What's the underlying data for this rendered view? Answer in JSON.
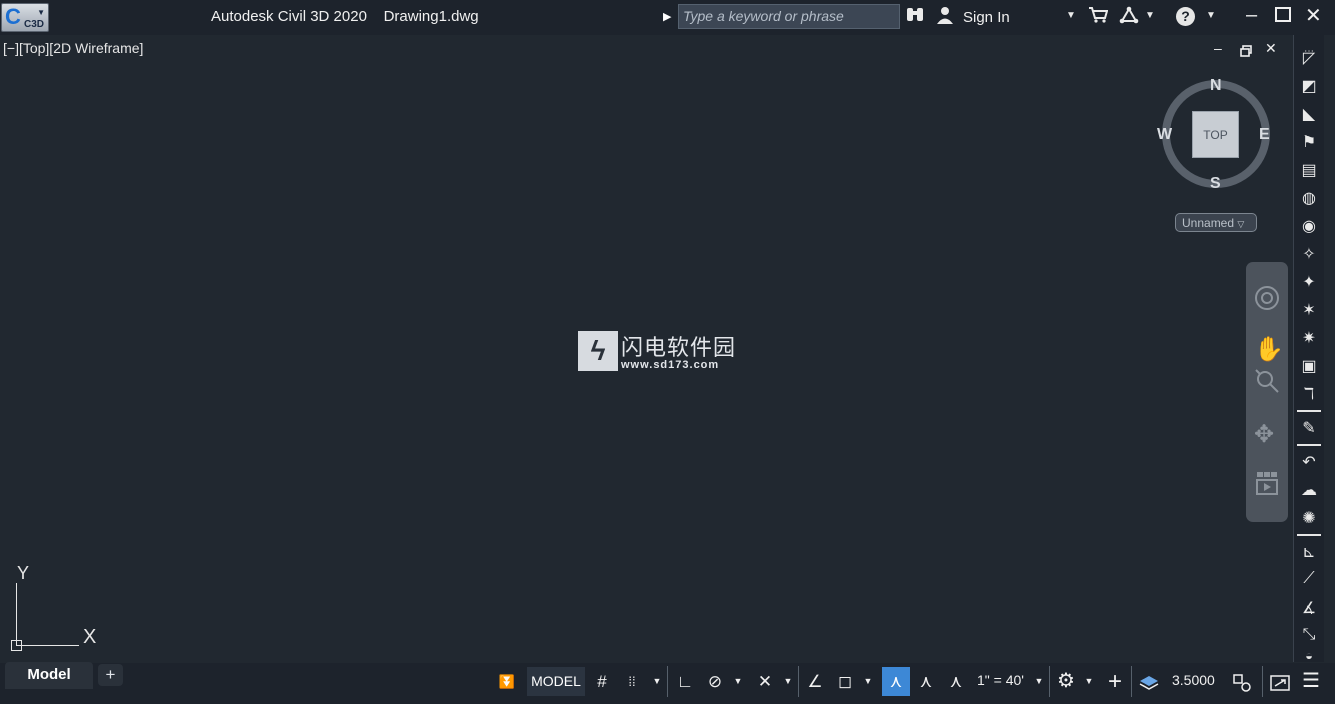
{
  "titlebar": {
    "app_badge": "C3D",
    "app_name": "Autodesk Civil 3D 2020",
    "document": "Drawing1.dwg",
    "search_placeholder": "Type a keyword or phrase",
    "sign_in": "Sign In"
  },
  "viewport": {
    "controls_label": "[−][Top][2D Wireframe]",
    "viewcube": {
      "north": "N",
      "south": "S",
      "east": "E",
      "west": "W",
      "face": "TOP",
      "ucs_menu": "Unnamed"
    },
    "ucs": {
      "y": "Y",
      "x": "X"
    },
    "watermark": {
      "name": "闪电软件园",
      "url": "www.sd173.com"
    }
  },
  "tabs": {
    "model": "Model",
    "add": "+"
  },
  "statusbar": {
    "model_space": "MODEL",
    "annotation_scale": "1\" = 40'",
    "lineweight_value": "3.5000"
  },
  "colors": {
    "canvas": "#212830",
    "chrome": "#1d232c",
    "accent": "#3d88d6"
  }
}
